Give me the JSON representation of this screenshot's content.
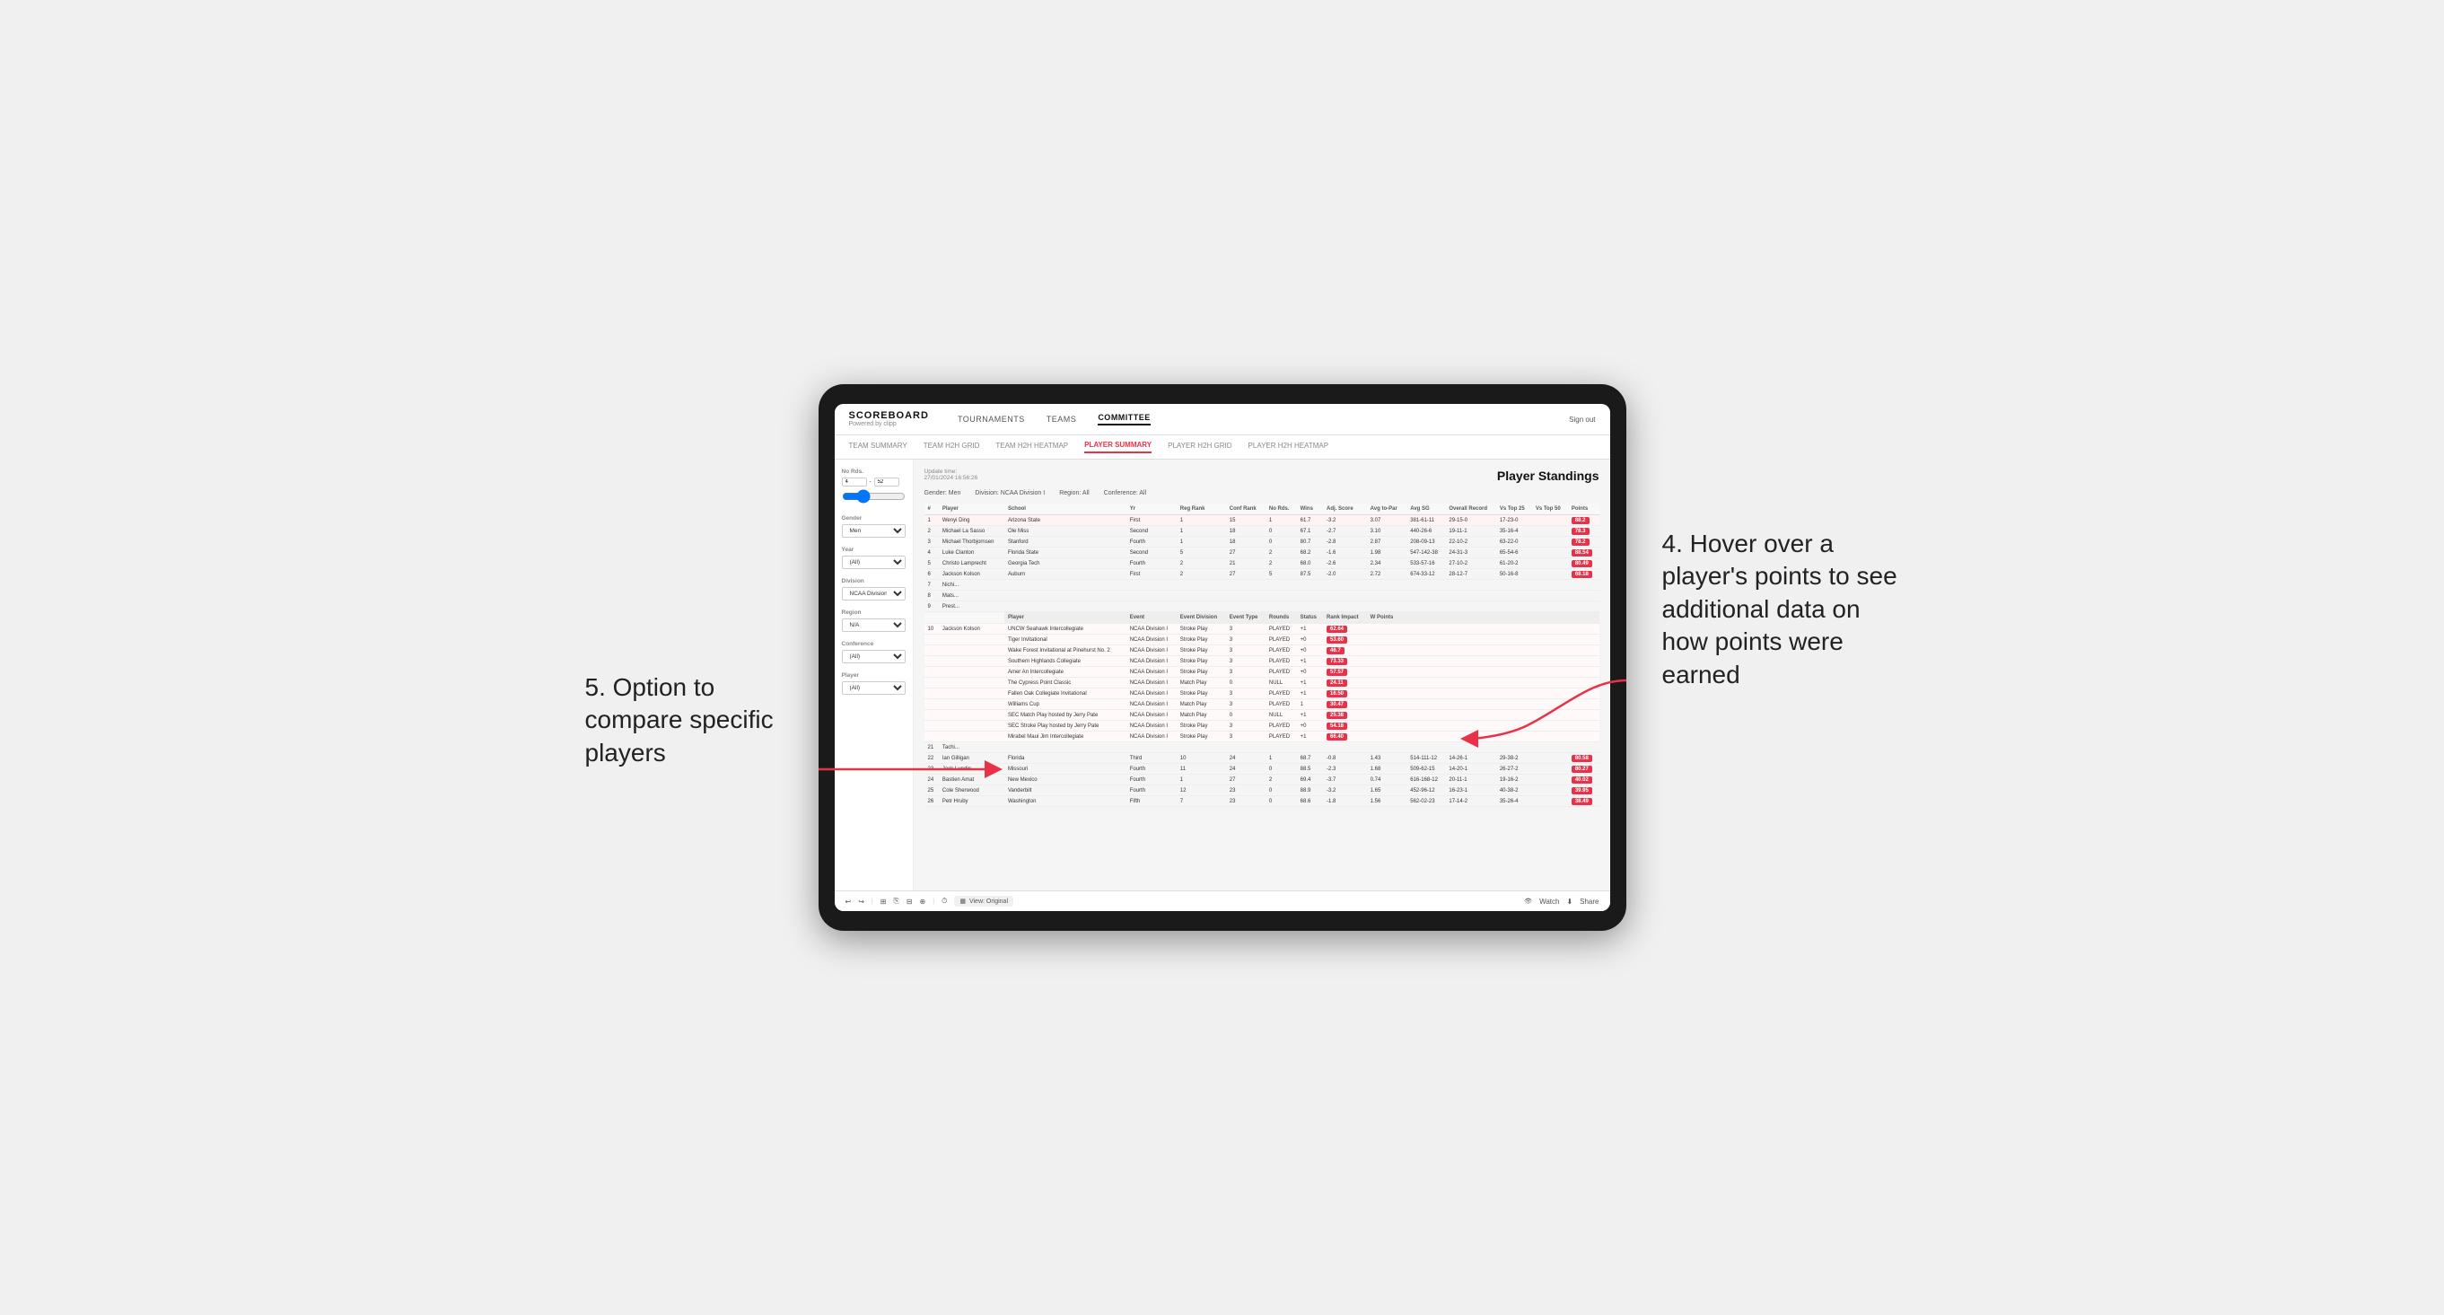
{
  "app": {
    "title": "SCOREBOARD",
    "powered_by": "Powered by clipp",
    "nav_items": [
      "TOURNAMENTS",
      "TEAMS",
      "COMMITTEE"
    ],
    "active_nav": "COMMITTEE",
    "sign_out": "Sign out",
    "sub_nav_items": [
      "TEAM SUMMARY",
      "TEAM H2H GRID",
      "TEAM H2H HEATMAP",
      "PLAYER SUMMARY",
      "PLAYER H2H GRID",
      "PLAYER H2H HEATMAP"
    ],
    "active_sub_nav": "PLAYER SUMMARY"
  },
  "sidebar": {
    "no_rds_label": "No Rds.",
    "no_rds_min": "4",
    "no_rds_max": "52",
    "gender_label": "Gender",
    "gender_value": "Men",
    "year_label": "Year",
    "year_value": "(All)",
    "division_label": "Division",
    "division_value": "NCAA Division I",
    "region_label": "Region",
    "region_value": "N/A",
    "conference_label": "Conference",
    "conference_value": "(All)",
    "player_label": "Player",
    "player_value": "(All)"
  },
  "panel": {
    "update_time_label": "Update time:",
    "update_time_value": "27/01/2024 16:56:26",
    "title": "Player Standings",
    "filters": {
      "gender_label": "Gender:",
      "gender_value": "Men",
      "division_label": "Division:",
      "division_value": "NCAA Division I",
      "region_label": "Region:",
      "region_value": "All",
      "conference_label": "Conference:",
      "conference_value": "All"
    },
    "table_headers": [
      "#",
      "Player",
      "School",
      "Yr",
      "Reg Rank",
      "Conf Rank",
      "No Rds.",
      "Wins",
      "Adj. Score",
      "Avg to-Par",
      "Avg SG",
      "Overall Record",
      "Vs Top 25",
      "Vs Top 50",
      "Points"
    ],
    "rows": [
      {
        "num": "1",
        "player": "Wenyi Ding",
        "school": "Arizona State",
        "yr": "First",
        "reg_rank": "1",
        "conf_rank": "15",
        "no_rds": "1",
        "wins": "61.7",
        "adj_score": "-3.2",
        "avg_to_par": "3.07",
        "avg_sg": "381-61-11",
        "overall": "29-15-0",
        "vs25": "17-23-0",
        "vs50": "",
        "points": "88.2",
        "highlight": true
      },
      {
        "num": "2",
        "player": "Michael La Sasso",
        "school": "Ole Miss",
        "yr": "Second",
        "reg_rank": "1",
        "conf_rank": "18",
        "no_rds": "0",
        "wins": "67.1",
        "adj_score": "-2.7",
        "avg_to_par": "3.10",
        "avg_sg": "440-26-6",
        "overall": "19-11-1",
        "vs25": "35-16-4",
        "vs50": "",
        "points": "78.3",
        "highlight": false
      },
      {
        "num": "3",
        "player": "Michael Thorbjornsen",
        "school": "Stanford",
        "yr": "Fourth",
        "reg_rank": "1",
        "conf_rank": "18",
        "no_rds": "0",
        "wins": "80.7",
        "adj_score": "-2.8",
        "avg_to_par": "2.87",
        "avg_sg": "208-09-13",
        "overall": "22-10-2",
        "vs25": "63-22-0",
        "vs50": "",
        "points": "78.2",
        "highlight": false
      },
      {
        "num": "4",
        "player": "Luke Clanton",
        "school": "Florida State",
        "yr": "Second",
        "reg_rank": "5",
        "conf_rank": "27",
        "no_rds": "2",
        "wins": "68.2",
        "adj_score": "-1.6",
        "avg_to_par": "1.98",
        "avg_sg": "547-142-38",
        "overall": "24-31-3",
        "vs25": "65-54-6",
        "vs50": "",
        "points": "88.54",
        "highlight": false
      },
      {
        "num": "5",
        "player": "Christo Lamprecht",
        "school": "Georgia Tech",
        "yr": "Fourth",
        "reg_rank": "2",
        "conf_rank": "21",
        "no_rds": "2",
        "wins": "68.0",
        "adj_score": "-2.6",
        "avg_to_par": "2.34",
        "avg_sg": "533-57-16",
        "overall": "27-10-2",
        "vs25": "61-20-2",
        "vs50": "",
        "points": "80.49",
        "highlight": false
      },
      {
        "num": "6",
        "player": "Jackson Kolson",
        "school": "Auburn",
        "yr": "First",
        "reg_rank": "2",
        "conf_rank": "27",
        "no_rds": "5",
        "wins": "87.5",
        "adj_score": "-2.0",
        "avg_to_par": "2.72",
        "avg_sg": "674-33-12",
        "overall": "28-12-7",
        "vs25": "50-16-8",
        "vs50": "",
        "points": "68.18",
        "highlight": false
      },
      {
        "num": "7",
        "player": "Nichi...",
        "school": "",
        "yr": "",
        "reg_rank": "",
        "conf_rank": "",
        "no_rds": "",
        "wins": "",
        "adj_score": "",
        "avg_to_par": "",
        "avg_sg": "",
        "overall": "",
        "vs25": "",
        "vs50": "",
        "points": "",
        "highlight": false
      },
      {
        "num": "8",
        "player": "Mats...",
        "school": "",
        "yr": "",
        "reg_rank": "",
        "conf_rank": "",
        "no_rds": "",
        "wins": "",
        "adj_score": "",
        "avg_to_par": "",
        "avg_sg": "",
        "overall": "",
        "vs25": "",
        "vs50": "",
        "points": "",
        "highlight": false
      },
      {
        "num": "9",
        "player": "Prest...",
        "school": "",
        "yr": "",
        "reg_rank": "",
        "conf_rank": "",
        "no_rds": "",
        "wins": "",
        "adj_score": "",
        "avg_to_par": "",
        "avg_sg": "",
        "overall": "",
        "vs25": "",
        "vs50": "",
        "points": "",
        "highlight": false
      }
    ],
    "tooltip_header": [
      "Player",
      "Event",
      "Event Division",
      "Event Type",
      "Rounds",
      "Status",
      "Rank Impact",
      "W Points"
    ],
    "tooltip_rows": [
      {
        "player": "Jackson Kolson",
        "event": "UNCW Seahawk Intercollegiate",
        "division": "NCAA Division I",
        "type": "Stroke Play",
        "rounds": "3",
        "status": "PLAYED",
        "rank_impact": "+1",
        "w_points": "62.64"
      },
      {
        "player": "",
        "event": "Tiger Invitational",
        "division": "NCAA Division I",
        "type": "Stroke Play",
        "rounds": "3",
        "status": "PLAYED",
        "rank_impact": "+0",
        "w_points": "53.60"
      },
      {
        "player": "",
        "event": "Wake Forest Invitational at Pinehurst No. 2",
        "division": "NCAA Division I",
        "type": "Stroke Play",
        "rounds": "3",
        "status": "PLAYED",
        "rank_impact": "+0",
        "w_points": "46.7"
      },
      {
        "player": "",
        "event": "Southern Highlands Collegiate",
        "division": "NCAA Division I",
        "type": "Stroke Play",
        "rounds": "3",
        "status": "PLAYED",
        "rank_impact": "+1",
        "w_points": "73.33"
      },
      {
        "player": "",
        "event": "Amer An Intercollegiate",
        "division": "NCAA Division I",
        "type": "Stroke Play",
        "rounds": "3",
        "status": "PLAYED",
        "rank_impact": "+0",
        "w_points": "57.57"
      },
      {
        "player": "",
        "event": "The Cypress Point Classic",
        "division": "NCAA Division I",
        "type": "Match Play",
        "rounds": "0",
        "status": "NULL",
        "rank_impact": "+1",
        "w_points": "24.11"
      },
      {
        "player": "",
        "event": "Fallen Oak Collegiate Invitational",
        "division": "NCAA Division I",
        "type": "Stroke Play",
        "rounds": "3",
        "status": "PLAYED",
        "rank_impact": "+1",
        "w_points": "16.50"
      },
      {
        "player": "",
        "event": "Williams Cup",
        "division": "NCAA Division I",
        "type": "Match Play",
        "rounds": "3",
        "status": "PLAYED",
        "rank_impact": "1",
        "w_points": "30.47"
      },
      {
        "player": "",
        "event": "SEC Match Play hosted by Jerry Pate",
        "division": "NCAA Division I",
        "type": "Match Play",
        "rounds": "0",
        "status": "NULL",
        "rank_impact": "+1",
        "w_points": "25.38"
      },
      {
        "player": "",
        "event": "SEC Stroke Play hosted by Jerry Pate",
        "division": "NCAA Division I",
        "type": "Stroke Play",
        "rounds": "3",
        "status": "PLAYED",
        "rank_impact": "+0",
        "w_points": "54.18"
      },
      {
        "player": "",
        "event": "Mirabel Maui Jim Intercollegiate",
        "division": "NCAA Division I",
        "type": "Stroke Play",
        "rounds": "3",
        "status": "PLAYED",
        "rank_impact": "+1",
        "w_points": "66.40"
      }
    ],
    "more_rows": [
      {
        "num": "21",
        "player": "Tachi...",
        "school": "",
        "yr": "",
        "reg_rank": "",
        "conf_rank": "",
        "no_rds": "",
        "wins": "",
        "adj_score": "",
        "avg_to_par": "",
        "avg_sg": "",
        "overall": "",
        "vs25": "",
        "vs50": "",
        "points": "",
        "highlight": false
      },
      {
        "num": "22",
        "player": "Ian Gilligan",
        "school": "Florida",
        "yr": "Third",
        "reg_rank": "10",
        "conf_rank": "24",
        "no_rds": "1",
        "wins": "68.7",
        "adj_score": "-0.8",
        "avg_to_par": "1.43",
        "avg_sg": "514-111-12",
        "overall": "14-26-1",
        "vs25": "29-38-2",
        "vs50": "",
        "points": "80.58"
      },
      {
        "num": "23",
        "player": "Jack Lundin",
        "school": "Missouri",
        "yr": "Fourth",
        "reg_rank": "11",
        "conf_rank": "24",
        "no_rds": "0",
        "wins": "88.5",
        "adj_score": "-2.3",
        "avg_to_par": "1.68",
        "avg_sg": "509-62-15",
        "overall": "14-20-1",
        "vs25": "26-27-2",
        "vs50": "",
        "points": "80.27"
      },
      {
        "num": "24",
        "player": "Bastien Amat",
        "school": "New Mexico",
        "yr": "Fourth",
        "reg_rank": "1",
        "conf_rank": "27",
        "no_rds": "2",
        "wins": "69.4",
        "adj_score": "-3.7",
        "avg_to_par": "0.74",
        "avg_sg": "616-168-12",
        "overall": "20-11-1",
        "vs25": "19-16-2",
        "vs50": "",
        "points": "40.02"
      },
      {
        "num": "25",
        "player": "Cole Sherwood",
        "school": "Vanderbilt",
        "yr": "Fourth",
        "reg_rank": "12",
        "conf_rank": "23",
        "no_rds": "0",
        "wins": "88.9",
        "adj_score": "-3.2",
        "avg_to_par": "1.65",
        "avg_sg": "452-96-12",
        "overall": "16-23-1",
        "vs25": "40-38-2",
        "vs50": "",
        "points": "39.95"
      },
      {
        "num": "26",
        "player": "Petr Hruby",
        "school": "Washington",
        "yr": "Fifth",
        "reg_rank": "7",
        "conf_rank": "23",
        "no_rds": "0",
        "wins": "68.6",
        "adj_score": "-1.8",
        "avg_to_par": "1.56",
        "avg_sg": "562-02-23",
        "overall": "17-14-2",
        "vs25": "35-26-4",
        "vs50": "",
        "points": "38.49"
      }
    ]
  },
  "toolbar": {
    "view_label": "View: Original",
    "watch_label": "Watch",
    "share_label": "Share"
  },
  "annotations": {
    "top_right": "4. Hover over a player's points to see additional data on how points were earned",
    "bottom_left": "5. Option to compare specific players"
  }
}
